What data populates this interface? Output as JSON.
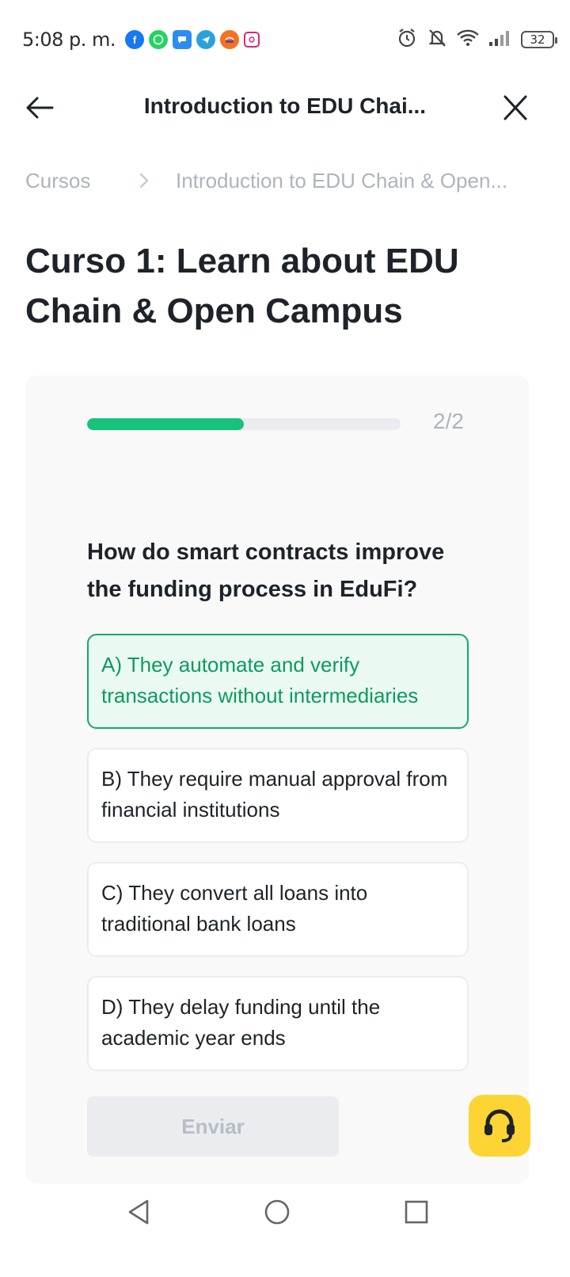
{
  "status_bar": {
    "time": "5:08 p. m.",
    "battery": "32",
    "notifications": [
      "facebook-icon",
      "whatsapp-icon",
      "messenger-icon",
      "telegram-icon",
      "app-icon",
      "instagram-icon"
    ]
  },
  "header": {
    "title": "Introduction to EDU Chai..."
  },
  "breadcrumb": {
    "first": "Cursos",
    "current": "Introduction to EDU Chain & Open..."
  },
  "course": {
    "title": "Curso 1: Learn about EDU Chain & Open Campus"
  },
  "quiz": {
    "progress_count": "2/2",
    "progress_fraction": 0.5,
    "question": "How do smart contracts improve the funding process in EduFi?",
    "options": [
      {
        "label": "A) They automate and verify transactions without intermediaries",
        "selected": true
      },
      {
        "label": "B) They require manual approval from financial institutions",
        "selected": false
      },
      {
        "label": "C) They convert all loans into traditional bank loans",
        "selected": false
      },
      {
        "label": "D) They delay funding until the academic year ends",
        "selected": false
      }
    ],
    "submit_label": "Enviar"
  },
  "colors": {
    "accent_green": "#17c27a",
    "selected_border": "#17a86a",
    "support_yellow": "#fcd535"
  }
}
